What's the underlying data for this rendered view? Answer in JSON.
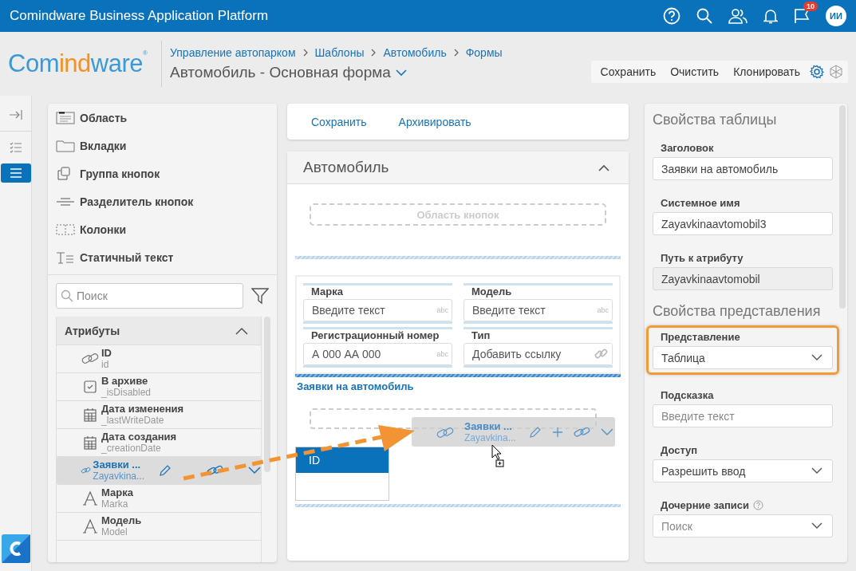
{
  "app_bar": {
    "title": "Comindware Business Application Platform",
    "notification_count": "10",
    "avatar": "ИИ"
  },
  "header": {
    "logo": [
      "Com",
      "ind",
      "ware"
    ],
    "logo_mark": "®",
    "breadcrumbs": [
      "Управление автопарком",
      "Шаблоны",
      "Автомобиль",
      "Формы"
    ],
    "title": "Автомобиль - Основная форма",
    "actions": [
      "Сохранить",
      "Очистить",
      "Клонировать"
    ]
  },
  "rail": [
    {
      "kind": "collapse",
      "selected": false
    },
    {
      "kind": "checklist",
      "selected": false
    },
    {
      "kind": "list",
      "selected": true
    }
  ],
  "elements": [
    {
      "kind": "area",
      "label": "Область"
    },
    {
      "kind": "tabs",
      "label": "Вкладки"
    },
    {
      "kind": "button_group",
      "label": "Группа кнопок"
    },
    {
      "kind": "button_divider",
      "label": "Разделитель кнопок"
    },
    {
      "kind": "columns",
      "label": "Колонки"
    },
    {
      "kind": "static_text",
      "label": "Статичный текст"
    }
  ],
  "search": {
    "placeholder": "Поиск"
  },
  "attributes": {
    "title": "Атрибуты",
    "expanded": true,
    "items": [
      {
        "kind": "link",
        "name": "ID",
        "system_name": "id",
        "selected": false
      },
      {
        "kind": "checkbox",
        "name": "В архиве",
        "system_name": "_isDisabled",
        "selected": false
      },
      {
        "kind": "date",
        "name": "Дата изменения",
        "system_name": "_lastWriteDate",
        "selected": false
      },
      {
        "kind": "date",
        "name": "Дата создания",
        "system_name": "_creationDate",
        "selected": false
      },
      {
        "kind": "link",
        "name": "Заявки ...",
        "system_name": "Zayavkina...",
        "selected": true
      },
      {
        "kind": "text",
        "name": "Марка",
        "system_name": "Marka",
        "selected": false
      },
      {
        "kind": "text",
        "name": "Модель",
        "system_name": "Model",
        "selected": false
      }
    ]
  },
  "form_toolbar": [
    "Сохранить",
    "Архивировать"
  ],
  "form": {
    "title": "Автомобиль",
    "expanded": true,
    "button_area": "Область кнопок",
    "fields": [
      {
        "kind": "text",
        "label": "Марка",
        "placeholder": "Введите текст",
        "hint": "abc"
      },
      {
        "kind": "text",
        "label": "Модель",
        "placeholder": "Введите текст",
        "hint": "abc"
      },
      {
        "kind": "text",
        "label": "Регистрационный номер",
        "placeholder": "А 000 АА 000",
        "hint": "abc"
      },
      {
        "kind": "link",
        "label": "Тип",
        "placeholder": "Добавить ссылку"
      }
    ],
    "table": {
      "title": "Заявки на автомобиль",
      "columns": [
        "ID"
      ]
    }
  },
  "drag_ghost": {
    "name": "Заявки ...",
    "system_name": "Zayavkina..."
  },
  "properties": [
    {
      "title": "Свойства таблицы",
      "fields": [
        {
          "kind": "input",
          "label": "Заголовок",
          "value": "Заявки на автомобиль",
          "highlighted": false
        },
        {
          "kind": "input",
          "label": "Системное имя",
          "value": "Zayavkinaavtomobil3",
          "highlighted": false
        },
        {
          "kind": "readonly",
          "label": "Путь к атрибуту",
          "value": "Zayavkinaavtomobil",
          "highlighted": false
        }
      ]
    },
    {
      "title": "Свойства представления",
      "fields": [
        {
          "kind": "select",
          "label": "Представление",
          "value": "Таблица",
          "highlighted": true
        },
        {
          "kind": "input",
          "label": "Подсказка",
          "placeholder": "Введите текст",
          "highlighted": false
        },
        {
          "kind": "select",
          "label": "Доступ",
          "value": "Разрешить ввод",
          "highlighted": false
        },
        {
          "kind": "select",
          "label": "Дочерние записи",
          "placeholder": "Поиск",
          "help": true,
          "highlighted": false
        }
      ]
    }
  ]
}
